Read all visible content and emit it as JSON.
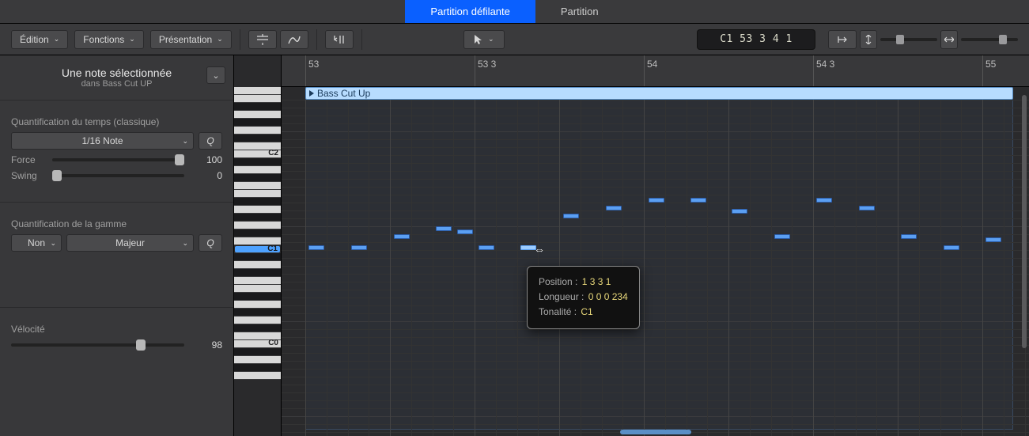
{
  "tabs": {
    "scroll": "Partition défilante",
    "score": "Partition"
  },
  "toolbar": {
    "edit": "Édition",
    "functions": "Fonctions",
    "view": "Présentation",
    "lcd": "C1  53 3 4 1"
  },
  "inspector": {
    "title": "Une note sélectionnée",
    "subtitle": "dans Bass Cut UP",
    "time_q_label": "Quantification du temps (classique)",
    "time_q_value": "1/16 Note",
    "q_btn": "Q",
    "strength_label": "Force",
    "strength_val": "100",
    "swing_label": "Swing",
    "swing_val": "0",
    "scale_q_label": "Quantification de la gamme",
    "scale_enable": "Non",
    "scale_mode": "Majeur",
    "velocity_label": "Vélocité",
    "velocity_val": "98"
  },
  "ruler": {
    "m53": "53",
    "m53b3": "53 3",
    "m54": "54",
    "m54b3": "54 3",
    "m55": "55"
  },
  "region": {
    "name": "Bass Cut Up"
  },
  "tooltip": {
    "pos_k": "Position :",
    "pos_v": "1 3 3 1",
    "len_k": "Longueur :",
    "len_v": "0 0 0 234",
    "pitch_k": "Tonalité :",
    "pitch_v": "C1"
  },
  "keys": {
    "c2": "C2",
    "c1": "C1",
    "c0": "C0"
  }
}
